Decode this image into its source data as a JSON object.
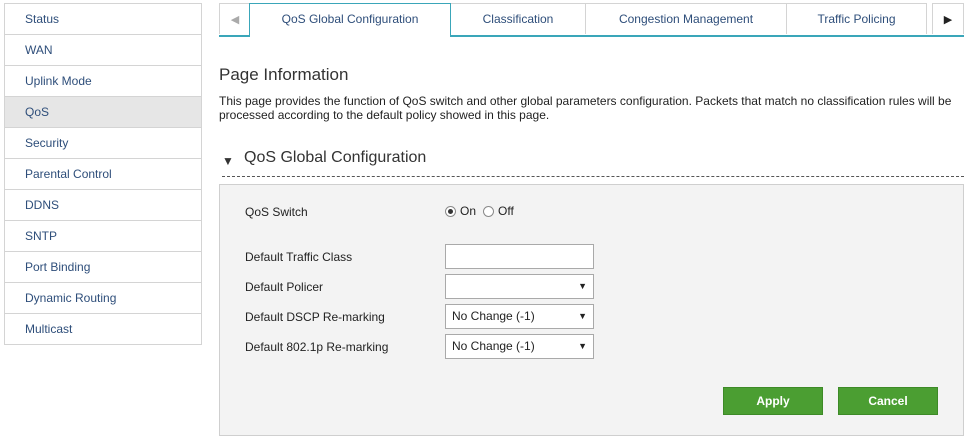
{
  "sidebar": {
    "items": [
      {
        "label": "Status"
      },
      {
        "label": "WAN"
      },
      {
        "label": "Uplink Mode"
      },
      {
        "label": "QoS",
        "active": true
      },
      {
        "label": "Security"
      },
      {
        "label": "Parental Control"
      },
      {
        "label": "DDNS"
      },
      {
        "label": "SNTP"
      },
      {
        "label": "Port Binding"
      },
      {
        "label": "Dynamic Routing"
      },
      {
        "label": "Multicast"
      }
    ]
  },
  "tabs": {
    "items": [
      {
        "label": "QoS Global Configuration",
        "active": true
      },
      {
        "label": "Classification"
      },
      {
        "label": "Congestion Management"
      },
      {
        "label": "Traffic Policing"
      }
    ],
    "prev_icon": "triangle-left-icon",
    "next_icon": "triangle-right-icon"
  },
  "page": {
    "title": "Page Information",
    "description": "This page provides the function of QoS switch and other global parameters configuration. Packets that match no classification rules will be processed according to the default policy showed in this page."
  },
  "section": {
    "title": "QoS Global Configuration",
    "collapse_icon": "triangle-down-icon"
  },
  "form": {
    "qos_switch": {
      "label": "QoS Switch",
      "options": [
        "On",
        "Off"
      ],
      "selected": "On"
    },
    "default_traffic_class": {
      "label": "Default Traffic Class",
      "value": ""
    },
    "default_policer": {
      "label": "Default Policer",
      "value": ""
    },
    "default_dscp": {
      "label": "Default DSCP Re-marking",
      "value": "No Change (-1)"
    },
    "default_8021p": {
      "label": "Default 802.1p Re-marking",
      "value": "No Change (-1)"
    }
  },
  "buttons": {
    "apply": "Apply",
    "cancel": "Cancel"
  },
  "colors": {
    "accent": "#3aa6b9",
    "button": "#4b9e32",
    "link": "#2e4e7a"
  }
}
